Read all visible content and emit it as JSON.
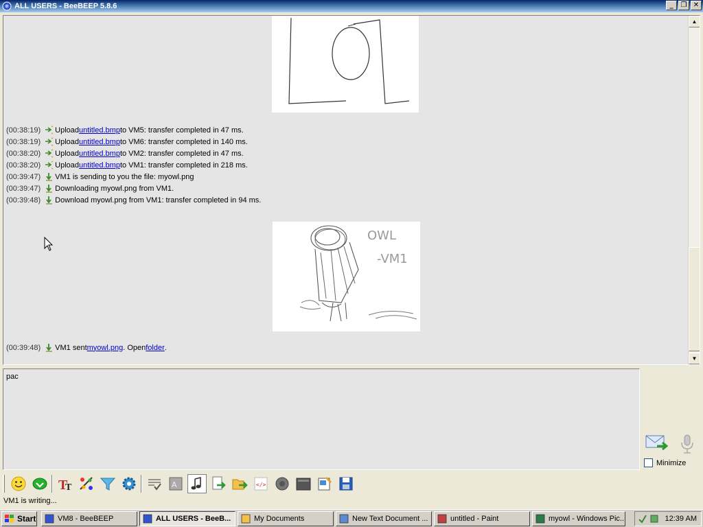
{
  "window": {
    "title": "ALL USERS - BeeBEEP 5.8.6"
  },
  "chat": {
    "messages": [
      {
        "time": "(00:38:19)",
        "pre": "Upload ",
        "link": "untitled.bmp",
        "post": " to VM5: transfer completed in 47 ms.",
        "icon": "upload-arrow-icon"
      },
      {
        "time": "(00:38:19)",
        "pre": "Upload ",
        "link": "untitled.bmp",
        "post": " to VM6: transfer completed in 140 ms.",
        "icon": "upload-arrow-icon"
      },
      {
        "time": "(00:38:20)",
        "pre": "Upload ",
        "link": "untitled.bmp",
        "post": " to VM2: transfer completed in 47 ms.",
        "icon": "upload-arrow-icon"
      },
      {
        "time": "(00:38:20)",
        "pre": "Upload ",
        "link": "untitled.bmp",
        "post": " to VM1: transfer completed in 218 ms.",
        "icon": "upload-arrow-icon"
      },
      {
        "time": "(00:39:47)",
        "text": "VM1 is sending to you the file: myowl.png",
        "icon": "download-arrow-icon"
      },
      {
        "time": "(00:39:47)",
        "text": "Downloading myowl.png from VM1.",
        "icon": "download-arrow-icon"
      },
      {
        "time": "(00:39:48)",
        "text": "Download myowl.png from VM1: transfer completed in 94 ms.",
        "icon": "download-arrow-icon"
      }
    ],
    "final_message": {
      "time": "(00:39:48)",
      "pre": "VM1 sent ",
      "link1": "myowl.png",
      "mid": ". Open ",
      "link2": "folder",
      "post": "."
    },
    "owl_sketch_text_1": "OWL",
    "owl_sketch_text_2": "-VM1"
  },
  "input": {
    "value": "pac"
  },
  "minimize_label": "Minimize",
  "status_text": "VM1 is writing...",
  "toolbar_icons": [
    "emoticon-icon",
    "save-chat-icon",
    "font-icon",
    "color-palette-icon",
    "filter-icon",
    "settings-icon",
    "spellcheck-icon",
    "word-completer-icon",
    "sound-icon",
    "send-file-icon",
    "send-folder-icon",
    "html-code-icon",
    "record-voice-icon",
    "screenshot-icon",
    "clipboard-icon",
    "save-icon"
  ],
  "taskbar": {
    "start_label": "Start",
    "tasks": [
      {
        "label": "VM8 - BeeBEEP",
        "active": false
      },
      {
        "label": "ALL USERS - BeeB...",
        "active": true
      },
      {
        "label": "My Documents",
        "active": false
      },
      {
        "label": "New Text Document ...",
        "active": false
      },
      {
        "label": "untitled - Paint",
        "active": false
      },
      {
        "label": "myowl - Windows Pic...",
        "active": false
      }
    ],
    "clock": "12:39 AM"
  }
}
